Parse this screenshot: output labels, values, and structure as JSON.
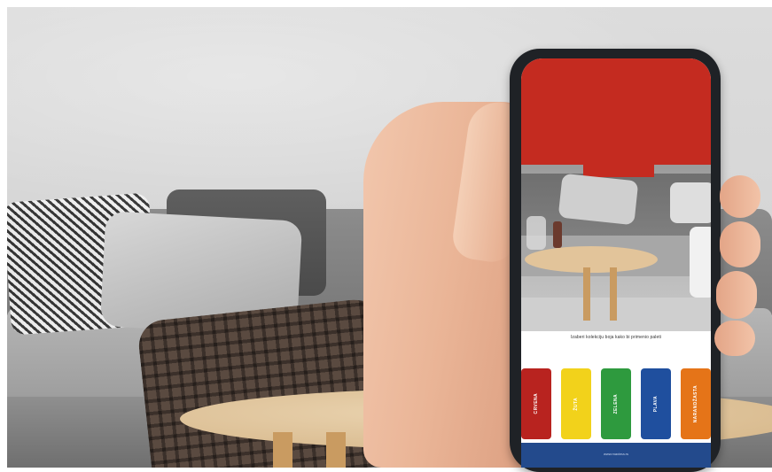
{
  "app": {
    "prompt_text": "Izaberi kolekciju boja kako bi primenio paleti",
    "footer_text": "www.maxima.rs",
    "hero_color": "#c42b20",
    "footer_color": "#234a8c"
  },
  "palette_buttons": [
    {
      "label": "CRVENA",
      "color": "#b8231f"
    },
    {
      "label": "ŽUTA",
      "color": "#f2d21b"
    },
    {
      "label": "ZELENA",
      "color": "#2e9a3e"
    },
    {
      "label": "PLAVA",
      "color": "#1f4f9e"
    },
    {
      "label": "NARANDŽASTA",
      "color": "#e57418"
    }
  ]
}
